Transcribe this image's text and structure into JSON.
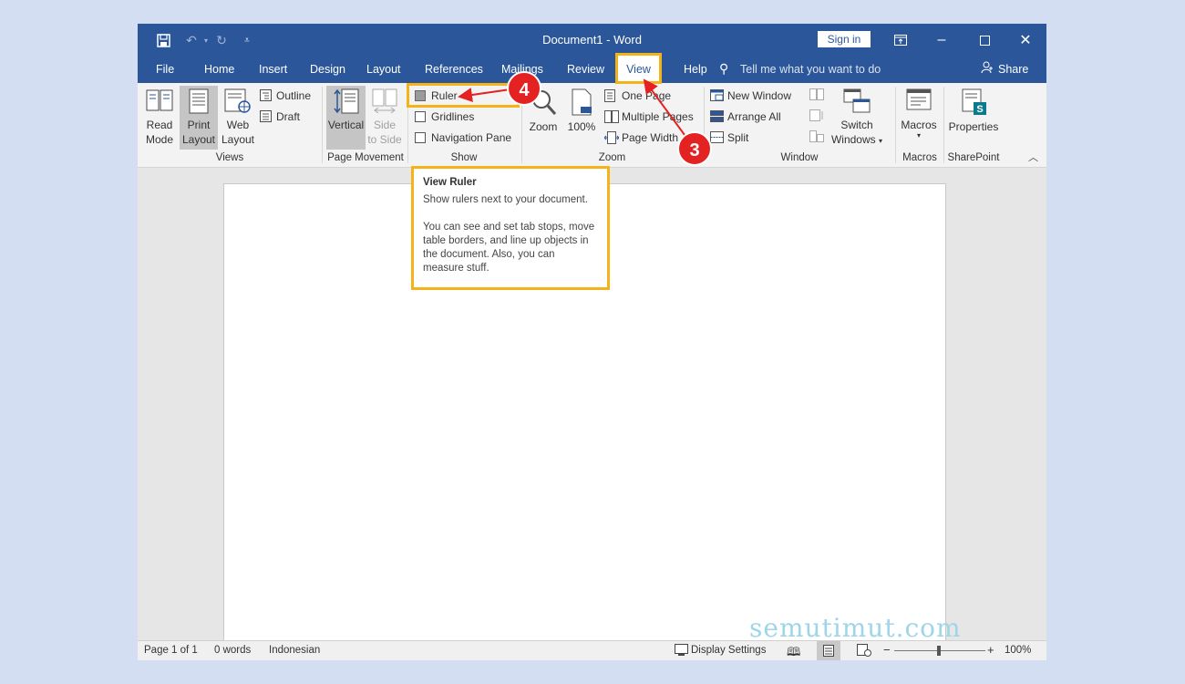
{
  "window": {
    "title": "Document1  -  Word",
    "signin_label": "Sign in",
    "share_label": "Share",
    "tell_me_placeholder": "Tell me what you want to do"
  },
  "menu": {
    "items": [
      "File",
      "Home",
      "Insert",
      "Design",
      "Layout",
      "References",
      "Mailings",
      "Review",
      "View",
      "Help"
    ]
  },
  "ribbon": {
    "views": {
      "read_mode": [
        "Read",
        "Mode"
      ],
      "print_layout": [
        "Print",
        "Layout"
      ],
      "web_layout": [
        "Web",
        "Layout"
      ],
      "outline": "Outline",
      "draft": "Draft",
      "group": "Views"
    },
    "page_movement": {
      "vertical": "Vertical",
      "side_to_side": [
        "Side",
        "to Side"
      ],
      "group": "Page Movement"
    },
    "show": {
      "ruler": "Ruler",
      "gridlines": "Gridlines",
      "navigation_pane": "Navigation Pane",
      "group": "Show"
    },
    "zoom": {
      "zoom": "Zoom",
      "hundred": "100%",
      "one_page": "One Page",
      "multiple_pages": "Multiple Pages",
      "page_width": "Page Width",
      "group": "Zoom"
    },
    "window": {
      "new_window": "New Window",
      "arrange_all": "Arrange All",
      "split": "Split",
      "switch_windows": [
        "Switch",
        "Windows"
      ],
      "group": "Window"
    },
    "macros": {
      "label": "Macros",
      "group": "Macros"
    },
    "sharepoint": {
      "label": "Properties",
      "group": "SharePoint"
    }
  },
  "tooltip": {
    "title": "View Ruler",
    "line1": "Show rulers next to your document.",
    "line2": "You can see and set tab stops, move table borders, and line up objects in the document. Also, you can measure stuff."
  },
  "annotations": {
    "step3": "3",
    "step4": "4"
  },
  "status": {
    "page": "Page 1 of 1",
    "words": "0 words",
    "language": "Indonesian",
    "display_settings": "Display Settings",
    "zoom": "100%"
  },
  "watermark": "semutimut.com",
  "colors": {
    "title_bar": "#2b579a",
    "highlight": "#f5b31a",
    "annotation": "#e52222"
  }
}
